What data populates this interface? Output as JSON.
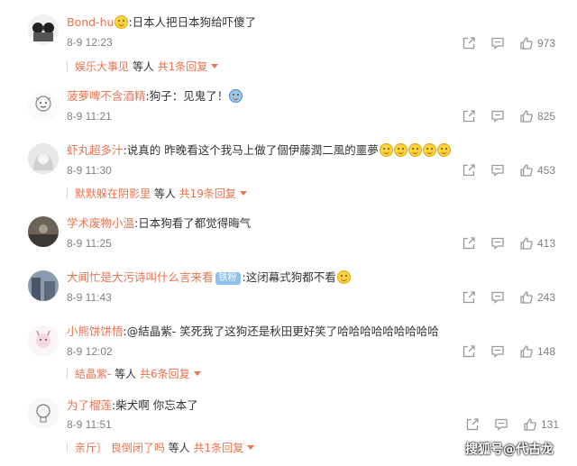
{
  "comments": [
    {
      "user": "Bond-hu",
      "text": ":日本人把日本狗给吓傻了",
      "time": "8-9 12:23",
      "likes": "973",
      "reply": {
        "from": "娱乐大事见",
        "mid": " 等人 ",
        "count": "共1条回复"
      }
    },
    {
      "user": "菠萝啤不含酒精",
      "text": ":狗子：见鬼了！",
      "time": "8-9 11:21",
      "likes": "825"
    },
    {
      "user": "虾丸超多汁",
      "text": ":说真的 昨晚看这个我马上做了個伊藤潤二風的噩夢",
      "time": "8-9 11:30",
      "likes": "453",
      "reply": {
        "from": "默默躲在阴影里",
        "mid": " 等人 ",
        "count": "共19条回复"
      }
    },
    {
      "user": "学术废物小温",
      "text": ":日本狗看了都觉得晦气",
      "time": "8-9 11:25",
      "likes": "413"
    },
    {
      "user": "大闻忙是大污诗叫什么言来看",
      "badge": "铁粉",
      "text": ":这闭幕式狗都不看",
      "time": "8-9 11:43",
      "likes": "243"
    },
    {
      "user": "小熊饼饼悟",
      "text": ":@結晶紫- 笑死我了这狗还是秋田更好笑了哈哈哈哈哈哈哈哈哈",
      "time": "8-9 12:02",
      "likes": "148",
      "reply": {
        "from": "結晶紫-",
        "mid": " 等人 ",
        "count": "共6条回复"
      }
    },
    {
      "user": "为了榴莲",
      "text": ":柴犬啊 你忘本了",
      "time": "8-9 11:51",
      "likes": "131",
      "reply": {
        "from": "亲斤〕 良倒闭了吗",
        "mid": " 等人 ",
        "count": "共1条回复"
      }
    }
  ],
  "watermark": "搜狐号@代古龙",
  "colors": {
    "username": "#eb7350",
    "meta": "#808080",
    "badge": "#8fc1ee"
  },
  "icons": [
    "share-icon",
    "comment-icon",
    "like-icon",
    "emoji-icon",
    "caret-down-icon"
  ]
}
